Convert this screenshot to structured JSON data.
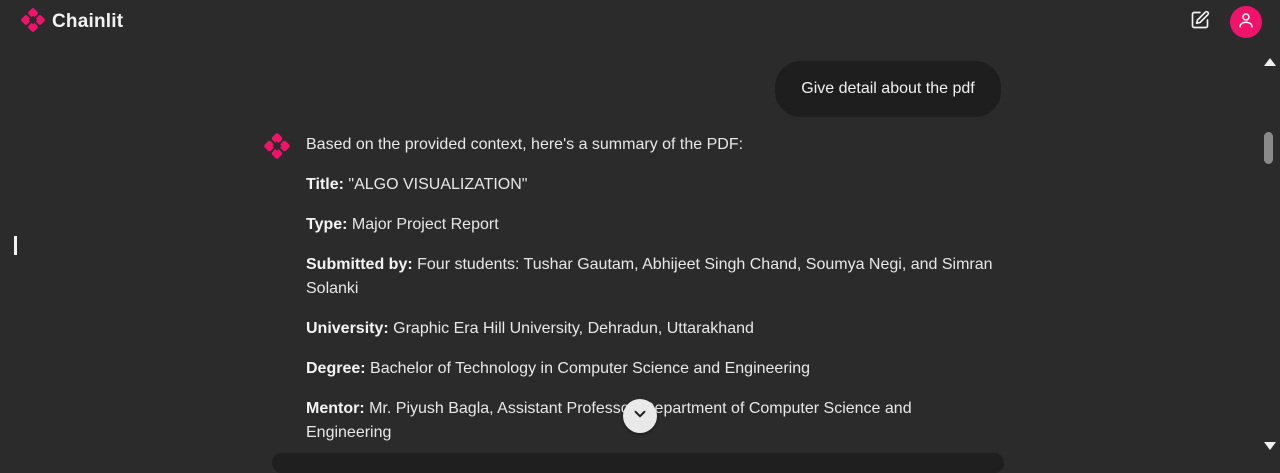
{
  "app": {
    "name": "Chainlit",
    "accent_color": "#f0136b"
  },
  "header": {
    "logo_icon": "chainlit-logo-icon",
    "new_chat_icon": "edit-icon",
    "user_icon": "user-icon"
  },
  "chat": {
    "user_message": "Give detail about the pdf",
    "assistant": {
      "intro": "Based on the provided context, here's a summary of the PDF:",
      "fields": [
        {
          "label": "Title:",
          "value": " \"ALGO VISUALIZATION\""
        },
        {
          "label": "Type:",
          "value": " Major Project Report"
        },
        {
          "label": "Submitted by:",
          "value": " Four students: Tushar Gautam, Abhijeet Singh Chand, Soumya Negi, and Simran Solanki"
        },
        {
          "label": "University:",
          "value": " Graphic Era Hill University, Dehradun, Uttarakhand"
        },
        {
          "label": "Degree:",
          "value": " Bachelor of Technology in Computer Science and Engineering"
        },
        {
          "label": "Mentor:",
          "value": " Mr. Piyush Bagla, Assistant Professor, Department of Computer Science and Engineering"
        }
      ]
    },
    "scroll_down_icon": "chevron-down-icon"
  }
}
